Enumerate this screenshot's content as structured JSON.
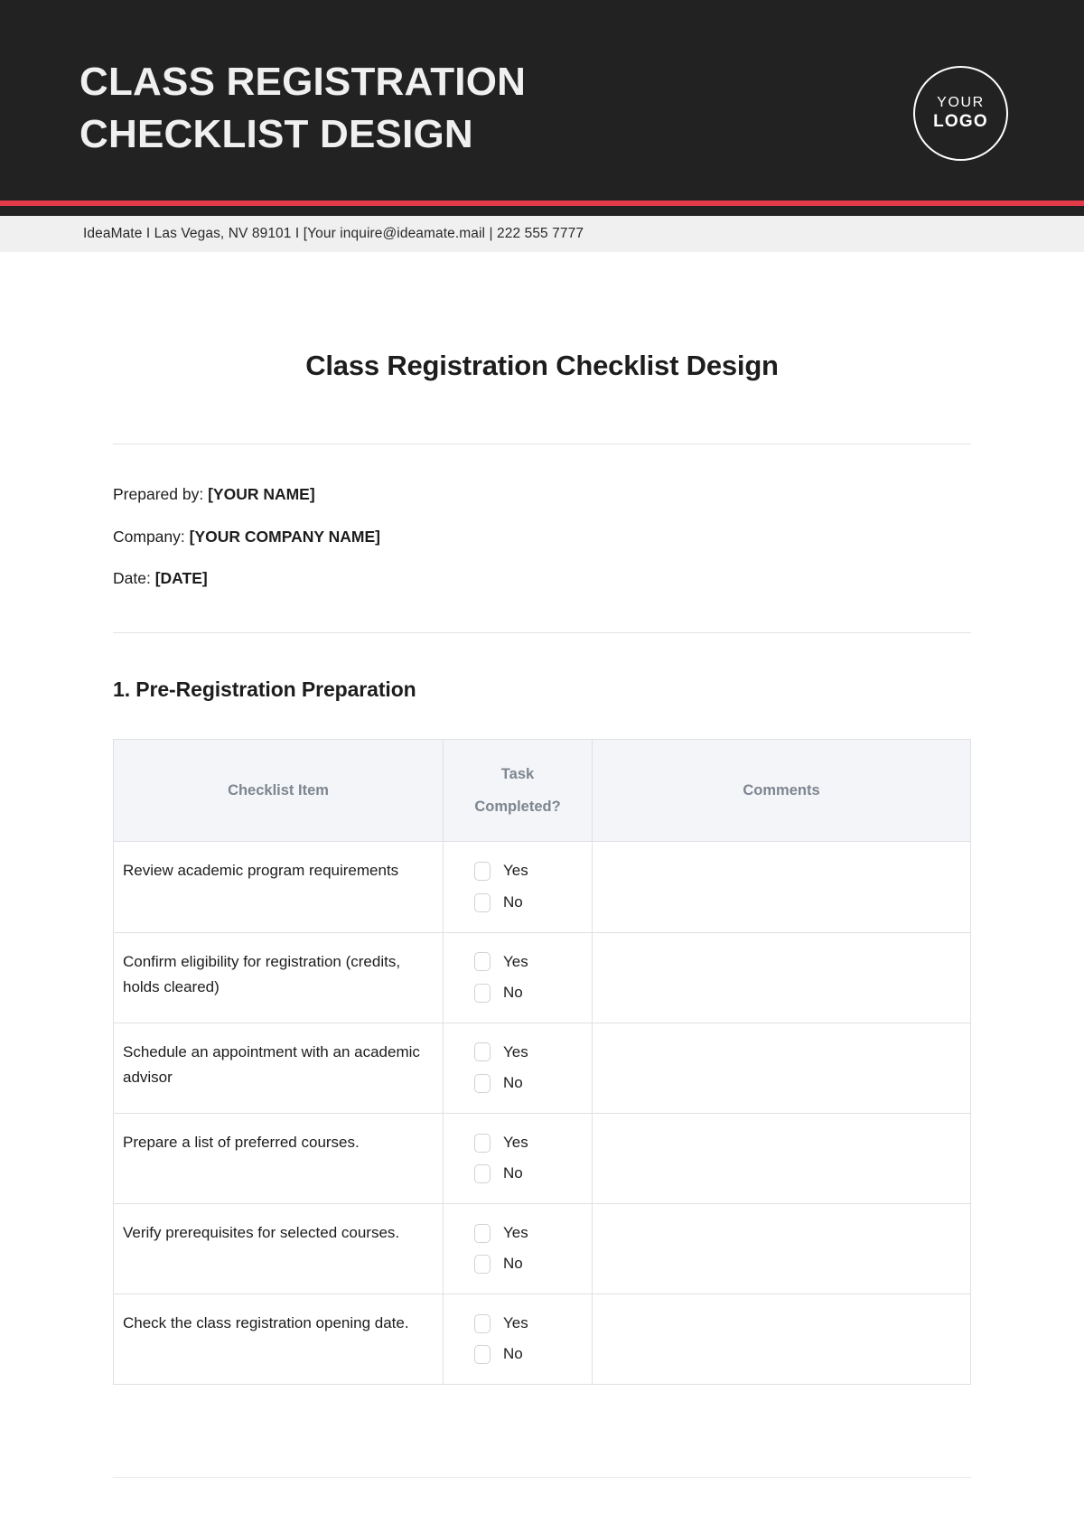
{
  "header": {
    "title": "CLASS REGISTRATION CHECKLIST DESIGN",
    "logo_line1": "YOUR",
    "logo_line2": "LOGO",
    "accent_color": "#e23a48",
    "background_color": "#222222"
  },
  "contact": {
    "text": "IdeaMate I  Las Vegas, NV 89101  I  [Your inquire@ideamate.mail | 222 555 7777"
  },
  "document": {
    "title": "Class Registration Checklist Design",
    "prepared_by_label": "Prepared by:",
    "prepared_by_value": "[YOUR NAME]",
    "company_label": "Company:",
    "company_value": "[YOUR COMPANY NAME]",
    "date_label": "Date:",
    "date_value": "[DATE]"
  },
  "section": {
    "heading": "1. Pre-Registration Preparation",
    "columns": [
      "Checklist Item",
      "Task Completed?",
      "Comments"
    ],
    "column_task_line1": "Task",
    "column_task_line2": "Completed?",
    "options": [
      "Yes",
      "No"
    ],
    "rows": [
      {
        "item": "Review academic program requirements",
        "comment": ""
      },
      {
        "item": "Confirm eligibility for registration (credits, holds cleared)",
        "comment": ""
      },
      {
        "item": "Schedule an appointment with an academic advisor",
        "comment": ""
      },
      {
        "item": "Prepare a list of preferred courses.",
        "comment": ""
      },
      {
        "item": "Verify prerequisites for selected courses.",
        "comment": ""
      },
      {
        "item": "Check the class registration opening date.",
        "comment": ""
      }
    ]
  }
}
